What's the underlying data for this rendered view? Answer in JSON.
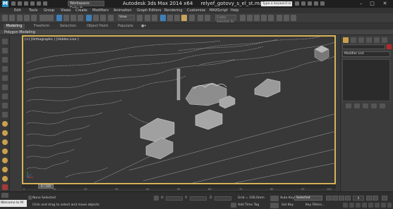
{
  "window": {
    "app_title": "Autodesk 3ds Max  2014 x64",
    "file_name": "relyef_gotovy_s_el_st.max",
    "workspace_label": "Workspace: Default",
    "search_placeholder": "Type a keyword or phrase",
    "min_icon": "minimize-icon",
    "max_icon": "maximize-icon",
    "close_icon": "close-icon"
  },
  "menu": [
    "Edit",
    "Tools",
    "Group",
    "Views",
    "Create",
    "Modifiers",
    "Animation",
    "Graph Editors",
    "Rendering",
    "Customize",
    "MAXScript",
    "Help"
  ],
  "toolbar": {
    "view_dropdown": "View",
    "selection_set_placeholder": "Create Selection Se"
  },
  "ribbon": {
    "tabs": [
      "Modeling",
      "Freeform",
      "Selection",
      "Object Paint",
      "Populate"
    ],
    "panel_label": "Polygon Modeling"
  },
  "viewport": {
    "label": "[+] [Orthographic ] [Hidden Line ]"
  },
  "command_panel": {
    "modifier_list": "Modifier List",
    "color_swatch": "#b52a2a"
  },
  "timeline": {
    "slider_label": "0 / 100",
    "ticks": [
      "0",
      "10",
      "20",
      "30",
      "40",
      "50",
      "60",
      "70",
      "80",
      "90",
      "100"
    ]
  },
  "status": {
    "maxscript_label": "Welcome to M",
    "selection_status": "None Selected",
    "prompt": "Click and drag to select and move objects",
    "x_label": "X:",
    "y_label": "Y:",
    "z_label": "Z:",
    "grid": "Grid = 100,0mm",
    "add_time_tag": "Add Time Tag",
    "auto_key": "Auto Key",
    "selected_dd": "Selected",
    "set_key": "Set Key",
    "key_filters": "Key Filters...",
    "frame_value": "0"
  },
  "colors": {
    "viewport_border": "#d6b357",
    "contours": "#c8c8c8",
    "buildings": "#9a9a9a"
  }
}
